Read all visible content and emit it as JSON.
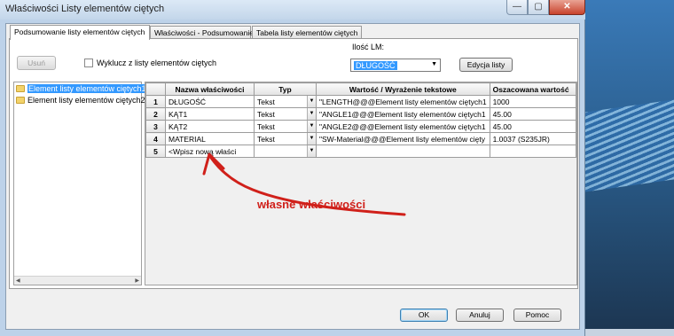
{
  "window": {
    "title": "Właściwości Listy elementów ciętych",
    "controls": {
      "minimize": "—",
      "maximize": "▢",
      "close": "✕"
    }
  },
  "tabs": [
    {
      "label": "Podsumowanie listy elementów ciętych",
      "active": true
    },
    {
      "label": "Właściwości - Podsumowanie",
      "active": false
    },
    {
      "label": "Tabela listy elementów ciętych",
      "active": false
    }
  ],
  "toolbar": {
    "delete_label": "Usuń",
    "exclude_label": "Wyklucz z listy elementów ciętych",
    "quantity_label": "Ilość LM:",
    "quantity_value": "DŁUGOŚĆ",
    "edit_list_label": "Edycja listy"
  },
  "tree": {
    "items": [
      {
        "label": "Element listy elementów ciętych1",
        "selected": true
      },
      {
        "label": "Element listy elementów ciętych2",
        "selected": false
      }
    ]
  },
  "grid": {
    "headers": [
      "Nazwa właściwości",
      "Typ",
      "Wartość / Wyrażenie tekstowe",
      "Oszacowana wartość"
    ],
    "rows": [
      {
        "num": "1",
        "name": "DŁUGOŚĆ",
        "type": "Tekst",
        "expr": "\"LENGTH@@@Element listy elementów ciętych1",
        "value": "1000"
      },
      {
        "num": "2",
        "name": "KĄT1",
        "type": "Tekst",
        "expr": "\"ANGLE1@@@Element listy elementów ciętych1",
        "value": "45.00"
      },
      {
        "num": "3",
        "name": "KĄT2",
        "type": "Tekst",
        "expr": "\"ANGLE2@@@Element listy elementów ciętych1",
        "value": "45.00"
      },
      {
        "num": "4",
        "name": "MATERIAL",
        "type": "Tekst",
        "expr": "\"SW-Material@@@Element listy elementów cięty",
        "value": "1.0037 (S235JR)"
      },
      {
        "num": "5",
        "name": "<Wpisz nową właści",
        "type": "",
        "expr": "",
        "value": ""
      }
    ]
  },
  "annotation": {
    "text": "własne właściwości",
    "color": "#d0201a"
  },
  "dialog_buttons": {
    "ok": "OK",
    "cancel": "Anuluj",
    "help": "Pomoc"
  },
  "colors": {
    "selection": "#3399ff",
    "window_frame": "#bdd2e9",
    "close_button": "#c8432c"
  }
}
